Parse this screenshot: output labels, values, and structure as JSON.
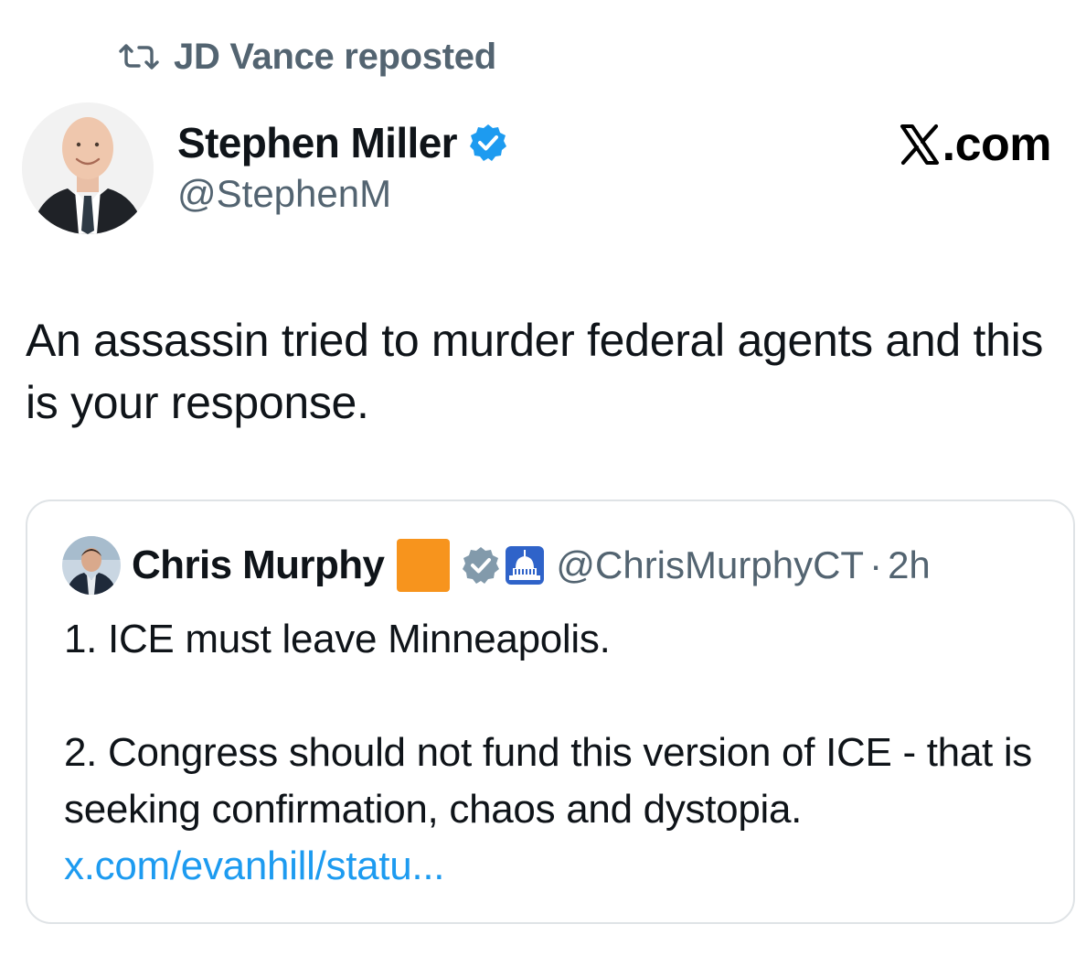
{
  "repost": {
    "icon": "repost-icon",
    "text": "JD Vance reposted"
  },
  "author": {
    "name": "Stephen Miller",
    "handle": "@StephenM",
    "verified_icon": "verified-badge-icon",
    "verified_color": "#1d9bf0"
  },
  "site": {
    "logo_icon": "x-logo-icon",
    "text": ".com"
  },
  "post": {
    "text": "An assassin tried to murder federal agents and this is your response."
  },
  "quote": {
    "name": "Chris Murphy",
    "square_color": "#f7941d",
    "verified_icon": "gray-verified-badge-icon",
    "capitol_icon": "capitol-badge-icon",
    "handle": "@ChrisMurphyCT",
    "separator": "·",
    "time": "2h",
    "line1": "1. ICE must leave Minneapolis.",
    "line2": "2. Congress should not fund this version of ICE - that is seeking confirmation, chaos and dystopia.",
    "link": "x.com/evanhill/statu..."
  },
  "colors": {
    "text": "#0f1419",
    "secondary": "#536471",
    "link": "#1d9bf0",
    "border": "#dfe3e6"
  }
}
